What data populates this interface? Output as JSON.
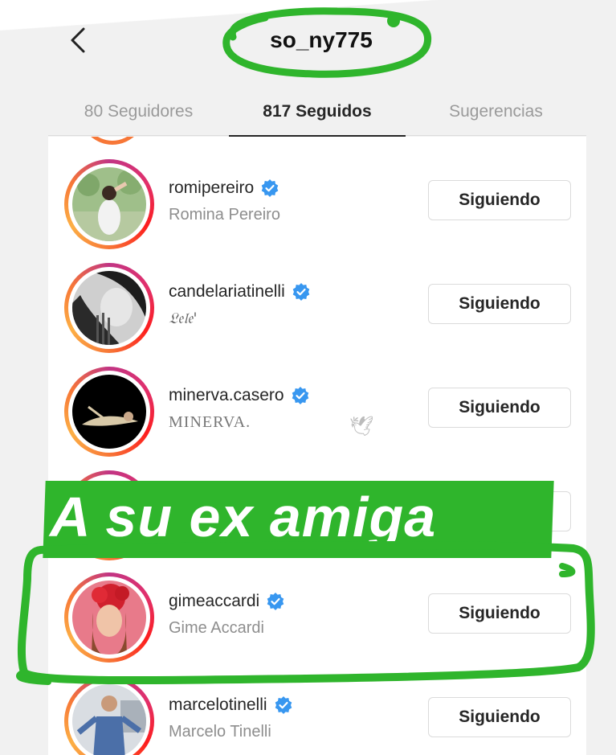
{
  "header": {
    "title": "so_ny775",
    "back_icon": "chevron-left-icon"
  },
  "tabs": [
    {
      "label": "80 Seguidores"
    },
    {
      "label": "817 Seguidos"
    },
    {
      "label": "Sugerencias"
    }
  ],
  "users": [
    {
      "username": "romipereiro",
      "fullname": "Romina Pereiro",
      "verified": true,
      "button": "Siguiendo"
    },
    {
      "username": "candelariatinelli",
      "fullname": "𝔏𝔢𝔩𝔢'",
      "verified": true,
      "button": "Siguiendo"
    },
    {
      "username": "minerva.casero",
      "fullname": "MINERVA.",
      "verified": true,
      "button": "Siguiendo",
      "emoji": "🕊"
    },
    {
      "username": "",
      "fullname": "",
      "verified": false,
      "button": ""
    },
    {
      "username": "gimeaccardi",
      "fullname": "Gime Accardi",
      "verified": true,
      "button": "Siguiendo"
    },
    {
      "username": "marcelotinelli",
      "fullname": "Marcelo Tinelli",
      "verified": true,
      "button": "Siguiendo"
    }
  ],
  "overlay": {
    "caption": "A su ex amiga",
    "marker_color": "#2fb52c"
  },
  "colors": {
    "verified": "#3897f0",
    "ring_start": "#c13584",
    "ring_end": "#fcaf45"
  }
}
